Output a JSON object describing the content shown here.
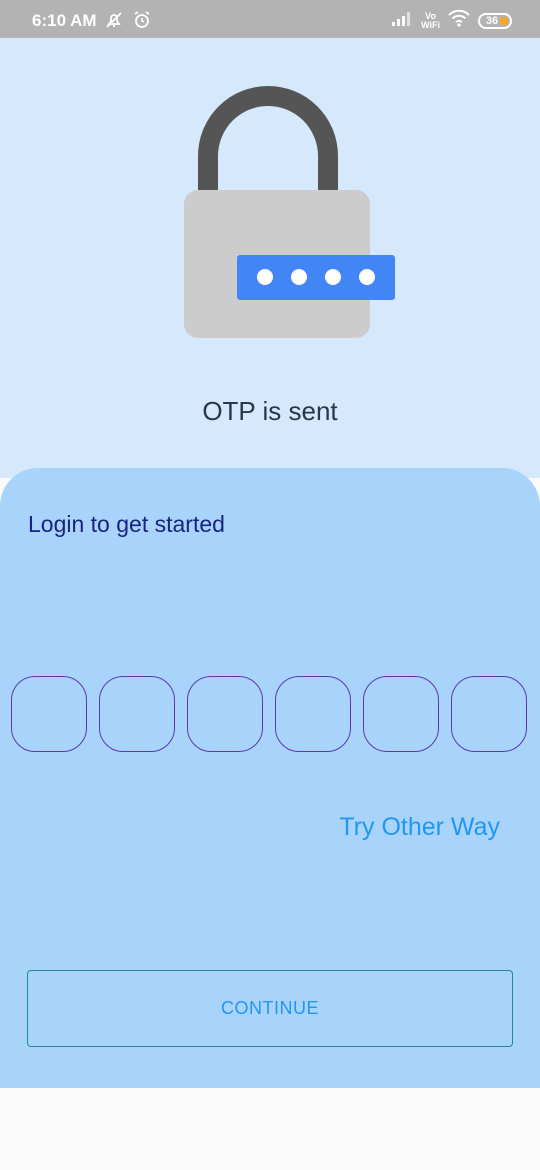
{
  "status_bar": {
    "time": "6:10 AM",
    "battery": "36",
    "vowifi_top": "Vo",
    "vowifi_bottom": "WiFi"
  },
  "header": {
    "message": "OTP is sent"
  },
  "card": {
    "title": "Login to get started",
    "otp_boxes": [
      "",
      "",
      "",
      "",
      "",
      ""
    ],
    "try_other_label": "Try Other Way",
    "continue_label": "CONTINUE"
  },
  "colors": {
    "top_bg": "#d6e8fb",
    "card_bg": "#a8d4fc",
    "accent": "#2196f3",
    "lock_key_bg": "#4285f4"
  }
}
